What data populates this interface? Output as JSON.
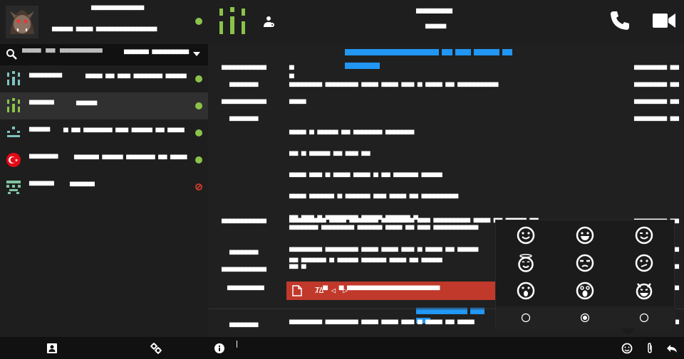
{
  "me": {
    "name": "▀▀▀▀▀▀▀▀▀▀▀▀▀",
    "status": "▀▀▀▀▀ ▀▀▀▀ ▀▀▀▀▀▀▀▀▀▀▀▀▀▀▀",
    "presence_color": "#8bc34a"
  },
  "search": {
    "placeholder": "▀▀▀▀ ▀▀ ▀▀▀▀▀▀▀▀▀",
    "filter_label": "▀▀▀▀▀▀ ▀▀▀▀▀▀▀▀▀"
  },
  "contacts": [
    {
      "name": "▀▀▀▀▀▀▀▀",
      "status": "▀▀▀▀ ▀▀ ▀▀▀ ▀▀▀▀▀▀▀ ▀▀▀▀▀",
      "presence": "online",
      "active": false
    },
    {
      "name": "▀▀▀▀▀▀",
      "status": "▀▀▀▀▀",
      "presence": "online",
      "active": true
    },
    {
      "name": "▀▀▀▀▀",
      "status": "▀ ▀▀ ▀▀▀▀▀▀▀ ▀▀▀ ▀▀▀▀▀ ▀▀ ▀▀▀▀",
      "presence": "online",
      "active": false
    },
    {
      "name": "▀▀▀▀▀▀▀",
      "status": "▀▀▀▀▀▀ ▀▀▀▀▀ ▀▀▀▀▀▀▀ ▀▀ ▀▀▀▀",
      "presence": "online",
      "active": false
    },
    {
      "name": "▀▀▀▀▀▀",
      "status": "▀▀▀▀▀▀",
      "presence": "blocked",
      "active": false
    }
  ],
  "header": {
    "name": "▀▀▀▀▀▀▀▀",
    "status": "▀▀▀▀▀"
  },
  "messages": [
    {
      "author": "▀▀▀▀▀▀▀▀▀▀▀",
      "lines": [
        "▀",
        "▀"
      ],
      "time": "▀▀▀▀▀▀▀▀ ▀▀"
    },
    {
      "author": "▀▀▀▀▀▀▀",
      "lines": [
        "▀▀▀▀▀▀▀▀ ▀▀▀▀▀▀▀▀ ▀▀▀▀ ▀▀▀▀ ▀▀▀ ▀ ▀▀▀▀ ▀▀ ▀▀▀▀▀▀▀▀▀▀"
      ],
      "time": "▀▀▀▀▀▀▀▀ ▀▀"
    },
    {
      "author": "▀▀▀▀▀▀▀▀▀▀▀",
      "lines": [
        "▀▀▀▀"
      ],
      "time": "▀▀▀▀▀▀▀▀ ▀▀"
    },
    {
      "author": "▀▀▀▀▀▀▀",
      "lines": [
        "▀▀▀▀ ▀ ▀▀▀▀▀ ▀▀ ▀▀▀▀▀▀▀ ▀▀▀▀▀▀▀",
        "▀▀ ▀ ▀▀▀▀▀ ▀▀ ▀▀▀ ▀▀",
        "▀▀▀▀ ▀▀▀ ▀ ▀▀▀▀ ▀▀▀▀ ▀ ▀▀ ▀▀▀▀▀▀ ▀▀▀▀▀",
        "▀▀▀▀ ▀▀▀▀▀▀ ▀ ▀▀▀▀▀▀ ▀▀▀ ▀▀▀▀ ▀▀ ▀▀▀▀▀▀▀▀▀",
        "▀▀ ▀▀▀ ▀ ▀▀▀▀▀▀▀▀ ▀▀▀▀▀ ▀▀▀▀▀▀ ▀",
        "",
        "▀▀ ▀▀▀▀▀▀ ▀ ▀▀▀▀▀ ▀▀▀▀▀▀ ▀▀▀▀ ▀▀ ▀▀▀▀▀"
      ],
      "time": "▀▀▀▀▀▀▀▀ ▀▀"
    },
    {
      "author": "▀▀▀▀▀▀▀▀▀▀▀",
      "lines": [
        "▀▀▀▀▀▀▀▀▀ ▀▀▀▀ ▀▀▀▀▀▀▀ ▀▀▀▀▀▀▀▀ ▀▀▀ ▀▀▀▀▀▀▀▀▀ ▀▀▀▀ ▀▀ ▀▀▀▀▀ ▀▀",
        "▀▀▀▀▀▀▀ ▀▀▀▀▀▀▀▀ ▀▀▀▀▀▀ ▀▀▀▀ ▀▀ ▀▀▀ ▀▀▀▀▀▀▀▀▀▀▀"
      ],
      "time": "▀▀▀▀▀▀▀▀ ▀▀"
    },
    {
      "author": "▀▀▀▀▀▀▀",
      "lines": [
        "▀▀▀▀▀▀▀▀ ▀▀▀▀▀▀▀▀ ▀▀▀▀ ▀▀▀▀ ▀▀▀ ▀ ▀▀▀▀ ▀▀ ▀▀▀▀▀"
      ],
      "time": "▀▀▀▀▀▀▀▀ ▀▀"
    },
    {
      "author": "▀▀▀▀▀▀▀▀▀▀▀",
      "lines": [
        "▀▀ ▀"
      ],
      "time": "▀▀▀▀▀▀▀▀ ▀▀"
    },
    {
      "author": "▀▀▀▀▀▀▀▀▀",
      "lines": [],
      "time": "▀▀▀▀▀▀▀▀ ▀▀"
    },
    {
      "author": "▀▀▀▀▀▀▀",
      "lines": [
        "▀▀▀▀▀▀▀▀ ▀▀▀▀▀▀▀▀ ▀▀▀▀ ▀▀▀▀ ▀▀▀ ▀ ▀▀▀▀ ▀▀ ▀▀▀▀"
      ],
      "time": "▀▀▀▀▀▀▀▀ ▀▀"
    }
  ],
  "top_link": "▀▀▀▀▀▀▀▀▀▀▀▀▀▀▀ ▀▀ ▀▀▀ ▀▀▀▀▀ ▀▀ ▀▀▀▀▀▀▀",
  "file": {
    "name": "ȾΔ▀ ◁ ▀▷▀▀▀▀▀▀▀▀▀▀▀▀▀▀▀▀▀▀▀▀▀▀▀",
    "color": "#c0392b"
  },
  "inline_link": "▀▀▀▀▀▀▀▀▀ ▀▀▀ ▀▀",
  "emoji_picker": {
    "emojis": [
      "slightly-smiling-face",
      "grinning-face",
      "winking-face",
      "smiling-face-with-halo",
      "unamused-face",
      "confused-face",
      "face-with-open-mouth",
      "astonished-face",
      "smiling-face-with-horns"
    ],
    "pages": 3,
    "active_page": 1
  },
  "composer": {
    "value": ""
  },
  "accent_color": "#2196f3",
  "online_color": "#8bc34a"
}
